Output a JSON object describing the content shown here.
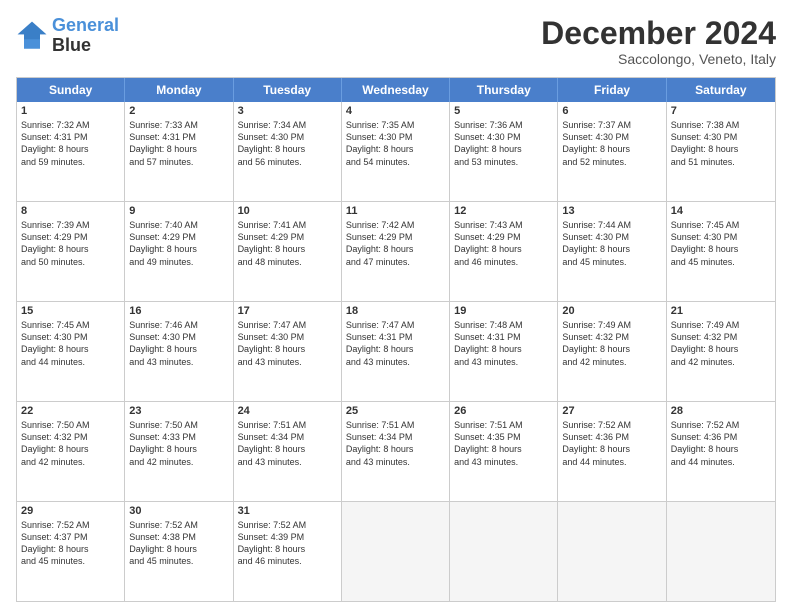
{
  "header": {
    "logo_line1": "General",
    "logo_line2": "Blue",
    "month": "December 2024",
    "location": "Saccolongo, Veneto, Italy"
  },
  "weekdays": [
    "Sunday",
    "Monday",
    "Tuesday",
    "Wednesday",
    "Thursday",
    "Friday",
    "Saturday"
  ],
  "weeks": [
    [
      {
        "day": "1",
        "lines": [
          "Sunrise: 7:32 AM",
          "Sunset: 4:31 PM",
          "Daylight: 8 hours",
          "and 59 minutes."
        ]
      },
      {
        "day": "2",
        "lines": [
          "Sunrise: 7:33 AM",
          "Sunset: 4:31 PM",
          "Daylight: 8 hours",
          "and 57 minutes."
        ]
      },
      {
        "day": "3",
        "lines": [
          "Sunrise: 7:34 AM",
          "Sunset: 4:30 PM",
          "Daylight: 8 hours",
          "and 56 minutes."
        ]
      },
      {
        "day": "4",
        "lines": [
          "Sunrise: 7:35 AM",
          "Sunset: 4:30 PM",
          "Daylight: 8 hours",
          "and 54 minutes."
        ]
      },
      {
        "day": "5",
        "lines": [
          "Sunrise: 7:36 AM",
          "Sunset: 4:30 PM",
          "Daylight: 8 hours",
          "and 53 minutes."
        ]
      },
      {
        "day": "6",
        "lines": [
          "Sunrise: 7:37 AM",
          "Sunset: 4:30 PM",
          "Daylight: 8 hours",
          "and 52 minutes."
        ]
      },
      {
        "day": "7",
        "lines": [
          "Sunrise: 7:38 AM",
          "Sunset: 4:30 PM",
          "Daylight: 8 hours",
          "and 51 minutes."
        ]
      }
    ],
    [
      {
        "day": "8",
        "lines": [
          "Sunrise: 7:39 AM",
          "Sunset: 4:29 PM",
          "Daylight: 8 hours",
          "and 50 minutes."
        ]
      },
      {
        "day": "9",
        "lines": [
          "Sunrise: 7:40 AM",
          "Sunset: 4:29 PM",
          "Daylight: 8 hours",
          "and 49 minutes."
        ]
      },
      {
        "day": "10",
        "lines": [
          "Sunrise: 7:41 AM",
          "Sunset: 4:29 PM",
          "Daylight: 8 hours",
          "and 48 minutes."
        ]
      },
      {
        "day": "11",
        "lines": [
          "Sunrise: 7:42 AM",
          "Sunset: 4:29 PM",
          "Daylight: 8 hours",
          "and 47 minutes."
        ]
      },
      {
        "day": "12",
        "lines": [
          "Sunrise: 7:43 AM",
          "Sunset: 4:29 PM",
          "Daylight: 8 hours",
          "and 46 minutes."
        ]
      },
      {
        "day": "13",
        "lines": [
          "Sunrise: 7:44 AM",
          "Sunset: 4:30 PM",
          "Daylight: 8 hours",
          "and 45 minutes."
        ]
      },
      {
        "day": "14",
        "lines": [
          "Sunrise: 7:45 AM",
          "Sunset: 4:30 PM",
          "Daylight: 8 hours",
          "and 45 minutes."
        ]
      }
    ],
    [
      {
        "day": "15",
        "lines": [
          "Sunrise: 7:45 AM",
          "Sunset: 4:30 PM",
          "Daylight: 8 hours",
          "and 44 minutes."
        ]
      },
      {
        "day": "16",
        "lines": [
          "Sunrise: 7:46 AM",
          "Sunset: 4:30 PM",
          "Daylight: 8 hours",
          "and 43 minutes."
        ]
      },
      {
        "day": "17",
        "lines": [
          "Sunrise: 7:47 AM",
          "Sunset: 4:30 PM",
          "Daylight: 8 hours",
          "and 43 minutes."
        ]
      },
      {
        "day": "18",
        "lines": [
          "Sunrise: 7:47 AM",
          "Sunset: 4:31 PM",
          "Daylight: 8 hours",
          "and 43 minutes."
        ]
      },
      {
        "day": "19",
        "lines": [
          "Sunrise: 7:48 AM",
          "Sunset: 4:31 PM",
          "Daylight: 8 hours",
          "and 43 minutes."
        ]
      },
      {
        "day": "20",
        "lines": [
          "Sunrise: 7:49 AM",
          "Sunset: 4:32 PM",
          "Daylight: 8 hours",
          "and 42 minutes."
        ]
      },
      {
        "day": "21",
        "lines": [
          "Sunrise: 7:49 AM",
          "Sunset: 4:32 PM",
          "Daylight: 8 hours",
          "and 42 minutes."
        ]
      }
    ],
    [
      {
        "day": "22",
        "lines": [
          "Sunrise: 7:50 AM",
          "Sunset: 4:32 PM",
          "Daylight: 8 hours",
          "and 42 minutes."
        ]
      },
      {
        "day": "23",
        "lines": [
          "Sunrise: 7:50 AM",
          "Sunset: 4:33 PM",
          "Daylight: 8 hours",
          "and 42 minutes."
        ]
      },
      {
        "day": "24",
        "lines": [
          "Sunrise: 7:51 AM",
          "Sunset: 4:34 PM",
          "Daylight: 8 hours",
          "and 43 minutes."
        ]
      },
      {
        "day": "25",
        "lines": [
          "Sunrise: 7:51 AM",
          "Sunset: 4:34 PM",
          "Daylight: 8 hours",
          "and 43 minutes."
        ]
      },
      {
        "day": "26",
        "lines": [
          "Sunrise: 7:51 AM",
          "Sunset: 4:35 PM",
          "Daylight: 8 hours",
          "and 43 minutes."
        ]
      },
      {
        "day": "27",
        "lines": [
          "Sunrise: 7:52 AM",
          "Sunset: 4:36 PM",
          "Daylight: 8 hours",
          "and 44 minutes."
        ]
      },
      {
        "day": "28",
        "lines": [
          "Sunrise: 7:52 AM",
          "Sunset: 4:36 PM",
          "Daylight: 8 hours",
          "and 44 minutes."
        ]
      }
    ],
    [
      {
        "day": "29",
        "lines": [
          "Sunrise: 7:52 AM",
          "Sunset: 4:37 PM",
          "Daylight: 8 hours",
          "and 45 minutes."
        ]
      },
      {
        "day": "30",
        "lines": [
          "Sunrise: 7:52 AM",
          "Sunset: 4:38 PM",
          "Daylight: 8 hours",
          "and 45 minutes."
        ]
      },
      {
        "day": "31",
        "lines": [
          "Sunrise: 7:52 AM",
          "Sunset: 4:39 PM",
          "Daylight: 8 hours",
          "and 46 minutes."
        ]
      },
      {
        "day": "",
        "lines": []
      },
      {
        "day": "",
        "lines": []
      },
      {
        "day": "",
        "lines": []
      },
      {
        "day": "",
        "lines": []
      }
    ]
  ]
}
